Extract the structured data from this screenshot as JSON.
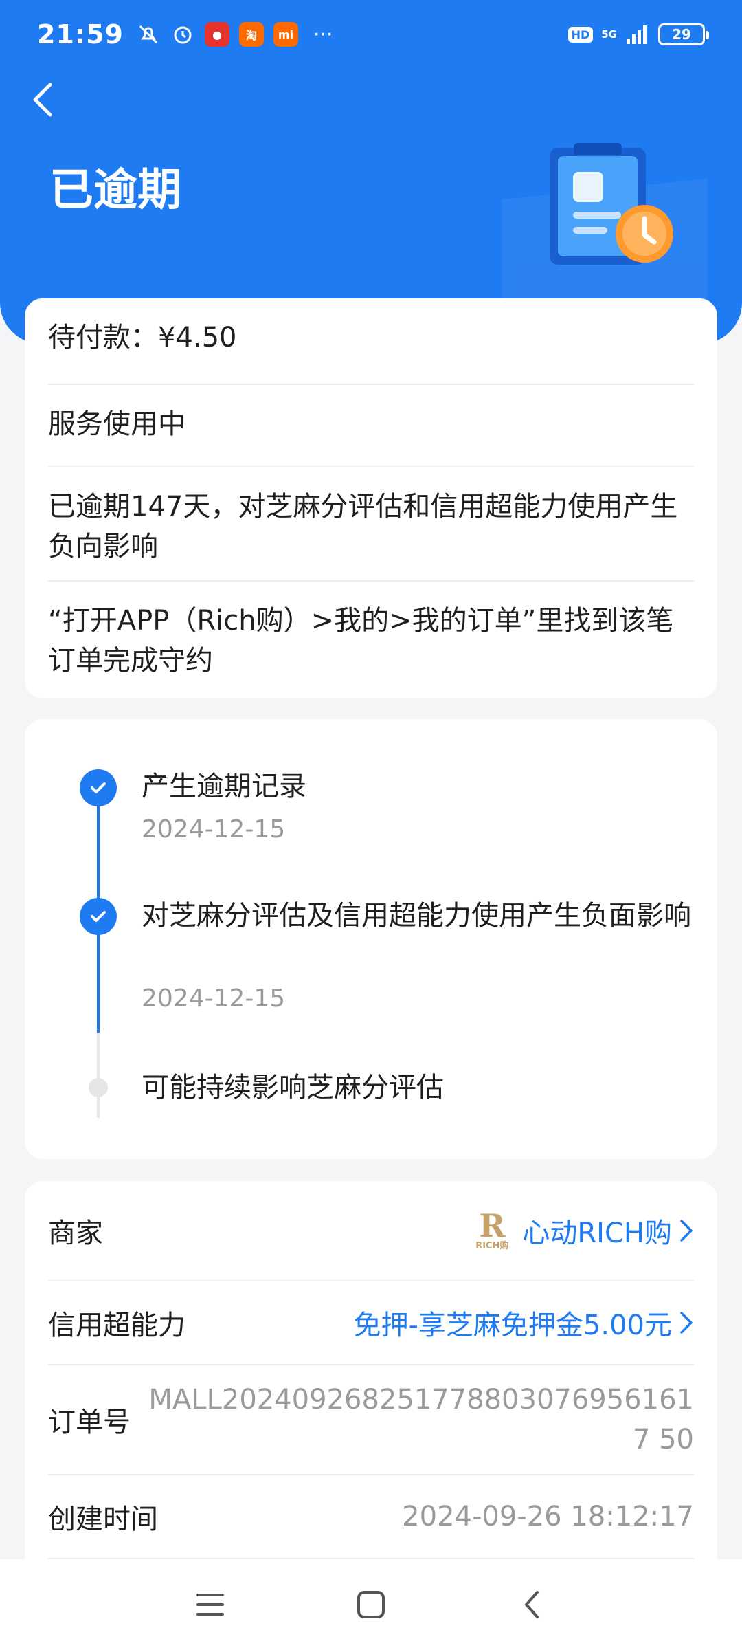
{
  "status_bar": {
    "time": "21:59",
    "network": "5G",
    "hd": "HD",
    "battery": "29",
    "more": "···",
    "apps": [
      {
        "name": "taobao",
        "label": "淘",
        "color": "#ff6a00"
      },
      {
        "name": "xiaomi",
        "label": "mi",
        "color": "#ff6900"
      }
    ]
  },
  "header": {
    "title": "已逾期"
  },
  "summary": {
    "pending_payment": "待付款：¥4.50",
    "service_status": "服务使用中",
    "overdue_notice": "已逾期147天，对芝麻分评估和信用超能力使用产生负向影响",
    "instruction": "“打开APP（Rich购）>我的>我的订单”里找到该笔订单完成守约"
  },
  "timeline": {
    "items": [
      {
        "title": "产生逾期记录",
        "date": "2024-12-15",
        "status": "done"
      },
      {
        "title": "对芝麻分评估及信用超能力使用产生负面影响",
        "date": "2024-12-15",
        "status": "done"
      },
      {
        "title": "可能持续影响芝麻分评估",
        "date": "",
        "status": "pending"
      }
    ]
  },
  "details": {
    "merchant_label": "商家",
    "merchant_logo_text": "RICH购",
    "merchant_logo_letter": "R",
    "merchant_value": "心动RICH购",
    "credit_label": "信用超能力",
    "credit_value": "免押-享芝麻免押金5.00元",
    "order_label": "订单号",
    "order_value": "MALL2024092682517788030769561617 50",
    "created_label": "创建时间",
    "created_value": "2024-09-26 18:12:17"
  },
  "colors": {
    "accent": "#1f7bf2",
    "header_bg": "#1f7bf2",
    "orange": "#ff9a2e"
  }
}
